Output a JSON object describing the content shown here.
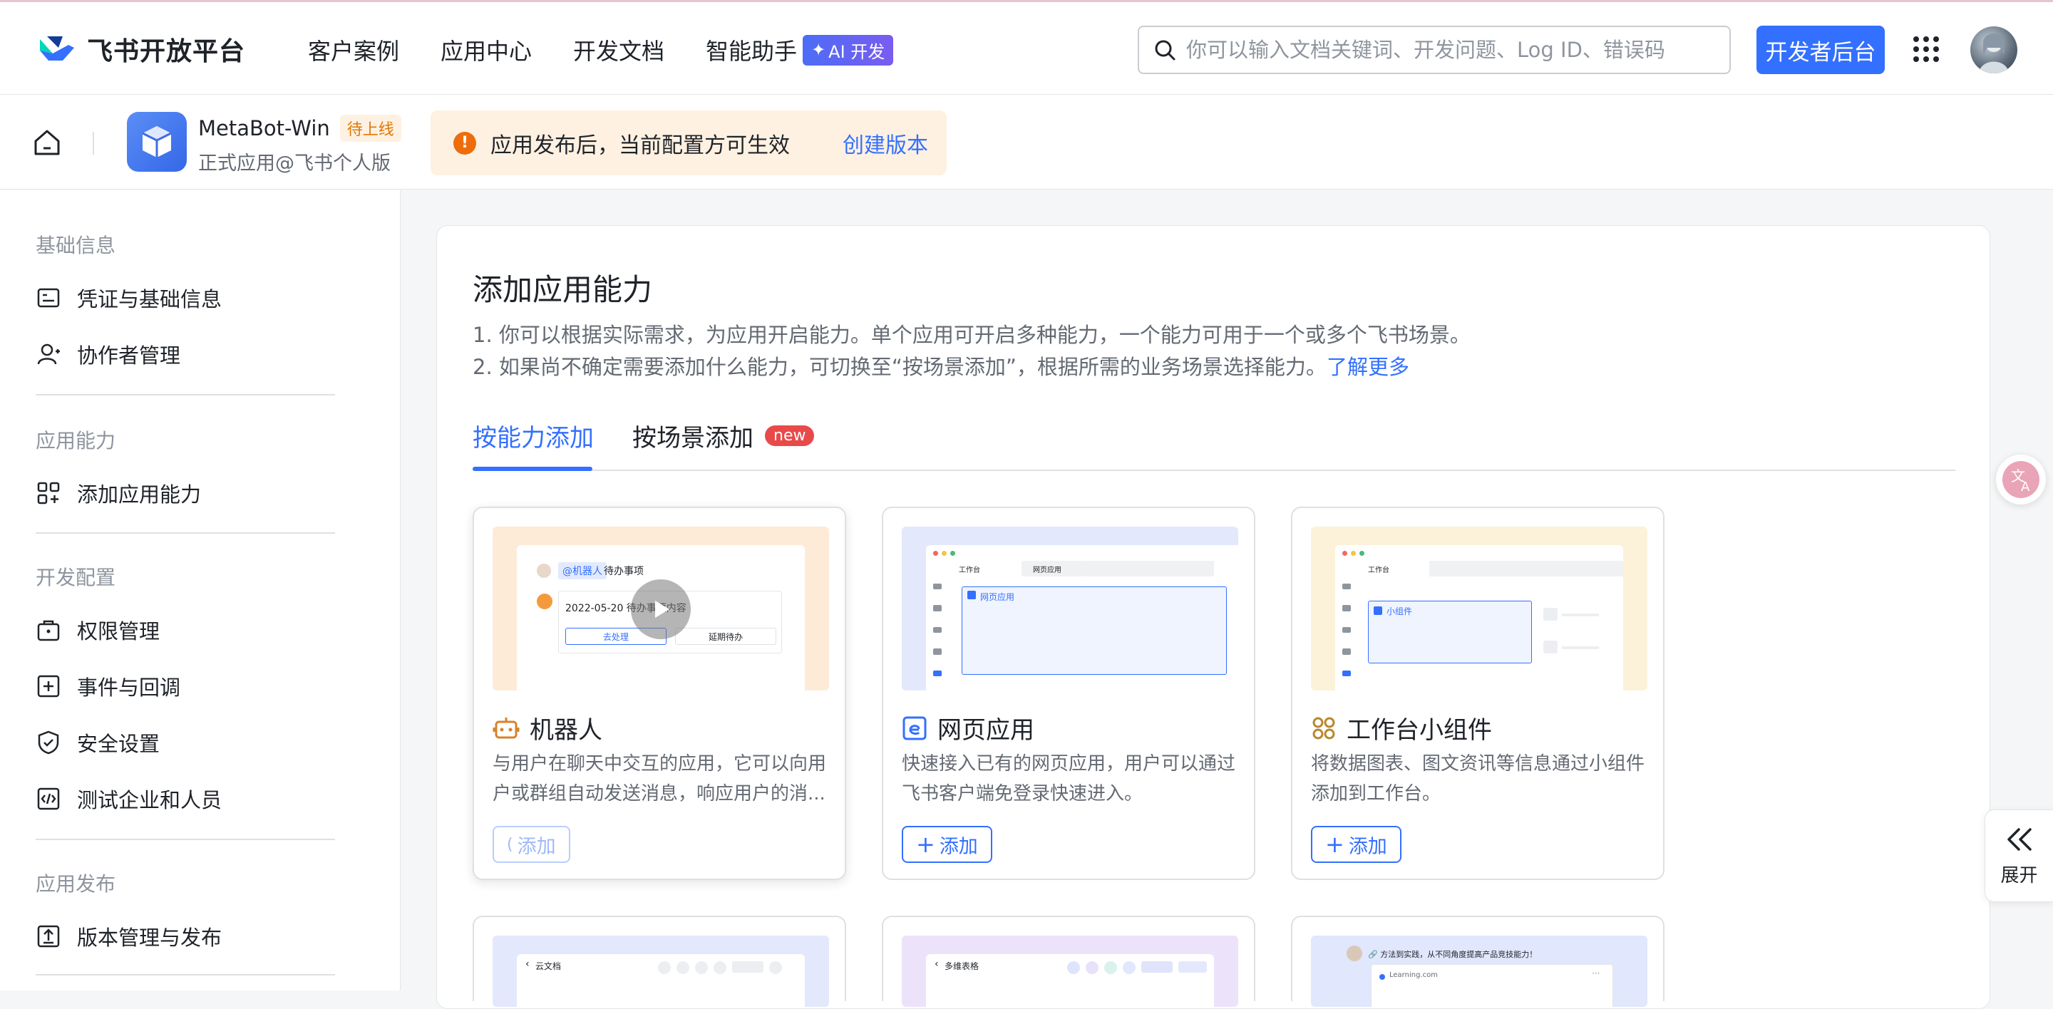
{
  "header": {
    "logo_text": "飞书开放平台",
    "nav": [
      {
        "label": "客户案例"
      },
      {
        "label": "应用中心"
      },
      {
        "label": "开发文档"
      },
      {
        "label": "智能助手"
      }
    ],
    "ai_badge": "AI 开发",
    "search_placeholder": "你可以输入文档关键词、开发问题、Log ID、错误码",
    "dev_console_label": "开发者后台"
  },
  "app": {
    "name": "MetaBot-Win",
    "status": "待上线",
    "subtitle": "正式应用@飞书个人版",
    "notice_text": "应用发布后，当前配置方可生效",
    "notice_link": "创建版本"
  },
  "sidebar": {
    "groups": [
      {
        "label": "基础信息",
        "items": [
          {
            "label": "凭证与基础信息"
          },
          {
            "label": "协作者管理"
          }
        ]
      },
      {
        "label": "应用能力",
        "items": [
          {
            "label": "添加应用能力"
          }
        ]
      },
      {
        "label": "开发配置",
        "items": [
          {
            "label": "权限管理"
          },
          {
            "label": "事件与回调"
          },
          {
            "label": "安全设置"
          },
          {
            "label": "测试企业和人员"
          }
        ]
      },
      {
        "label": "应用发布",
        "items": [
          {
            "label": "版本管理与发布"
          }
        ]
      }
    ]
  },
  "main": {
    "title": "添加应用能力",
    "desc1": "1. 你可以根据实际需求，为应用开启能力。单个应用可开启多种能力，一个能力可用于一个或多个飞书场景。",
    "desc2": "2. 如果尚不确定需要添加什么能力，可切换至“按场景添加”，根据所需的业务场景选择能力。",
    "desc2_link": "了解更多",
    "tabs": [
      {
        "label": "按能力添加",
        "active": true
      },
      {
        "label": "按场景添加",
        "badge": "new"
      }
    ],
    "capabilities": [
      {
        "title": "机器人",
        "desc": "与用户在聊天中交互的应用，它可以向用户或群组自动发送消息，响应用户的消...",
        "add_label": "添加",
        "thumb": {
          "chip": "@机器人",
          "todo": "待办事项",
          "date": "2022-05-20 待办事项内容",
          "btn1": "去处理",
          "btn2": "延期待办"
        }
      },
      {
        "title": "网页应用",
        "desc": "快速接入已有的网页应用，用户可以通过飞书客户端免登录快速进入。",
        "add_label": "添加",
        "thumb": {
          "tab1": "工作台",
          "tab2": "网页应用",
          "panel": "网页应用"
        }
      },
      {
        "title": "工作台小组件",
        "desc": "将数据图表、图文资讯等信息通过小组件添加到工作台。",
        "add_label": "添加",
        "thumb": {
          "tab1": "工作台",
          "panel": "小组件"
        }
      }
    ],
    "row2_thumbs": [
      {
        "label": "云文档"
      },
      {
        "label": "多维表格"
      },
      {
        "label": "方法到实践，从不同角度提高产品竞技能力！",
        "sub": "Learning.com"
      }
    ]
  },
  "floating": {
    "expand_label": "展开"
  }
}
